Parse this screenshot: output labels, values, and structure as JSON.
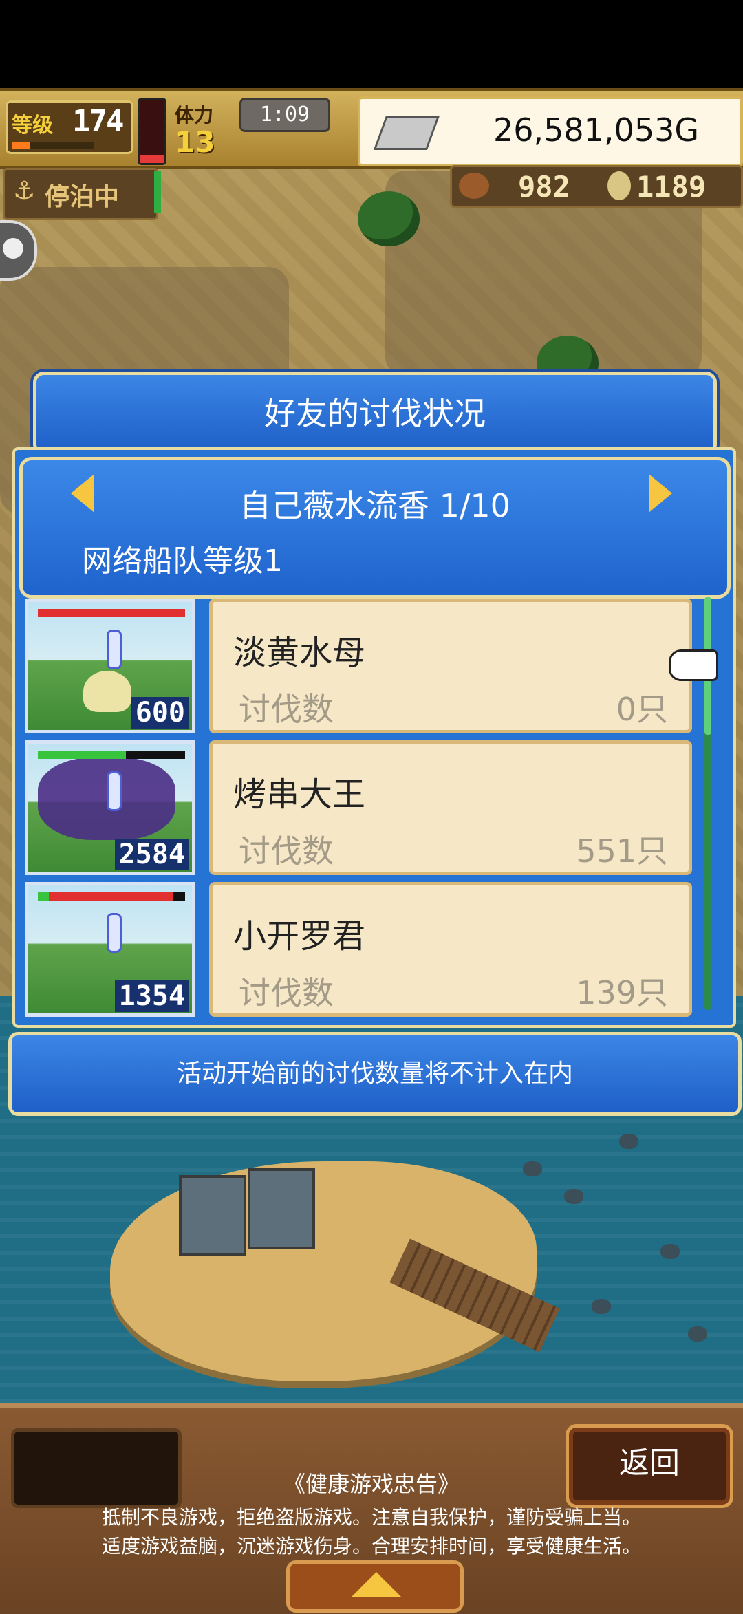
{
  "hud": {
    "level_label": "等级",
    "level": "174",
    "level_progress": 0.22,
    "stamina_label": "体力",
    "stamina": "13",
    "stamina_gauge": 0.12,
    "time": "1:09",
    "gold": "26,581,053G"
  },
  "status": {
    "dock_label": "停泊中",
    "food": "982",
    "coins": "1189"
  },
  "dialog": {
    "title": "好友的讨伐状况",
    "friend_name": "自己薇水流香 1/10",
    "fleet_rank": "网络船队等级1",
    "rows": [
      {
        "name": "淡黄水母",
        "kills_label": "讨伐数",
        "kills": "0只",
        "hp_count": "600",
        "hp": 1.0
      },
      {
        "name": "烤串大王",
        "kills_label": "讨伐数",
        "kills": "551只",
        "hp_count": "2584",
        "hp": 0.6
      },
      {
        "name": "小开罗君",
        "kills_label": "讨伐数",
        "kills": "139只",
        "hp_count": "1354",
        "hp": 0.92
      }
    ],
    "notice": "活动开始前的讨伐数量将不计入在内"
  },
  "bottom": {
    "back_label": "返回",
    "warning_title": "《健康游戏忠告》",
    "warning_line1": "抵制不良游戏，拒绝盗版游戏。注意自我保护，谨防受骗上当。",
    "warning_line2": "适度游戏益脑，沉迷游戏伤身。合理安排时间，享受健康生活。"
  }
}
